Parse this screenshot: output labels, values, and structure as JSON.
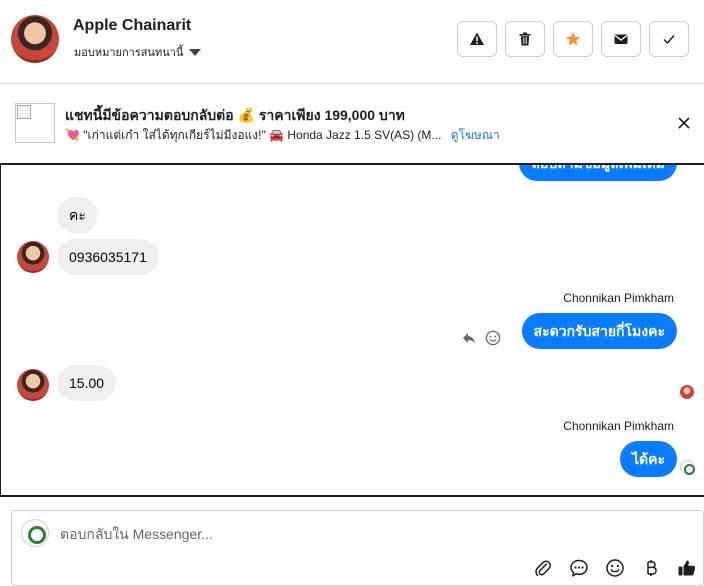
{
  "header": {
    "name": "Apple Chainarit",
    "assign_label": "มอบหมายการสนทนานี้",
    "actions": [
      {
        "icon": "warning-icon"
      },
      {
        "icon": "trash-icon"
      },
      {
        "icon": "star-icon",
        "color": "#f7923a"
      },
      {
        "icon": "envelope-icon"
      },
      {
        "icon": "check-icon"
      }
    ]
  },
  "ad": {
    "title": "แชทนี้มีข้อความตอบกลับต่อ 💰 ราคาเพียง 199,000 บาท",
    "subtitle": "💘 \"เก่าแต่เก๋า ใส่ได้ทุกเกียร์ไม่มีงอแง!\" 🚘 Honda Jazz 1.5 SV(AS) (M...",
    "link": "ดูโฆษณา"
  },
  "messages": [
    {
      "dir": "out",
      "text": "สอบถามข้อมูลเพิ่มเติม"
    },
    {
      "dir": "in",
      "text": "คะ"
    },
    {
      "dir": "in",
      "text": "0936035171"
    },
    {
      "dir": "out",
      "sender": "Chonnikan Pimkham",
      "text": "สะดวกรับสายกี่โมงคะ"
    },
    {
      "dir": "in",
      "text": "15.00"
    },
    {
      "dir": "out",
      "sender": "Chonnikan Pimkham",
      "text": "ได้คะ"
    }
  ],
  "composer": {
    "placeholder": "ตอบกลับใน Messenger..."
  },
  "colors": {
    "brand_blue": "#0a7cff",
    "link_blue": "#1877f2",
    "incoming_bubble": "#f0f0f0",
    "star": "#f7923a"
  }
}
